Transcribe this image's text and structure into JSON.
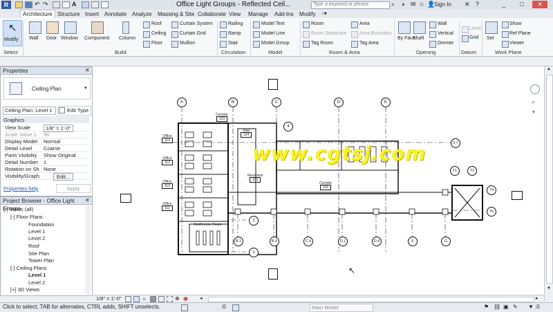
{
  "titlebar": {
    "title": "Office Light Groups - Reflected Ceil...",
    "search_placeholder": "Type a keyword or phrase",
    "signin": "Sign In",
    "min": "_",
    "max": "□",
    "close": "✕"
  },
  "tabs": [
    "Architecture",
    "Structure",
    "Insert",
    "Annotate",
    "Analyze",
    "Massing & Site",
    "Collaborate",
    "View",
    "Manage",
    "Add-Ins",
    "Modify"
  ],
  "ribbon": {
    "select": "Select",
    "build": {
      "title": "Build",
      "modify": "Modify",
      "wall": "Wall",
      "door": "Door",
      "window": "Window",
      "component": "Component",
      "column": "Column",
      "roof": "Roof",
      "ceiling": "Ceiling",
      "floor": "Floor",
      "curtain_system": "Curtain System",
      "curtain_grid": "Curtain Grid",
      "mullion": "Mullion"
    },
    "circulation": {
      "title": "Circulation",
      "railing": "Railing",
      "ramp": "Ramp",
      "stair": "Stair"
    },
    "model": {
      "title": "Model",
      "model_text": "Model Text",
      "model_line": "Model Line",
      "model_group": "Model Group"
    },
    "room_area": {
      "title": "Room & Area",
      "room": "Room",
      "room_separator": "Room Separator",
      "tag_room": "Tag Room",
      "area": "Area",
      "area_boundary": "Area Boundary",
      "tag_area": "Tag Area"
    },
    "opening": {
      "title": "Opening",
      "by_face": "By Face",
      "shaft": "Shaft",
      "wall": "Wall",
      "vertical": "Vertical",
      "dormer": "Dormer"
    },
    "datum": {
      "title": "Datum",
      "level": "Level",
      "grid": "Grid"
    },
    "work_plane": {
      "title": "Work Plane",
      "set": "Set",
      "show": "Show",
      "ref_plane": "Ref Plane",
      "viewer": "Viewer"
    }
  },
  "properties": {
    "header": "Properties",
    "type": "Ceiling Plan",
    "selector": "Ceiling Plan: Level 1",
    "edit_type": "Edit Type",
    "section": "Graphics",
    "rows": [
      {
        "k": "View Scale",
        "v": "1/8\" = 1'-0\""
      },
      {
        "k": "Scale Value   1:",
        "v": "96"
      },
      {
        "k": "Display Model",
        "v": "Normal"
      },
      {
        "k": "Detail Level",
        "v": "Coarse"
      },
      {
        "k": "Parts Visibility",
        "v": "Show Original"
      },
      {
        "k": "Detail Number",
        "v": "1"
      },
      {
        "k": "Rotation on Sh...",
        "v": "None"
      },
      {
        "k": "Visibility/Graph...",
        "v": "Edit..."
      }
    ],
    "help": "Properties help",
    "apply": "Apply"
  },
  "browser": {
    "header": "Project Browser - Office Light Groups",
    "nodes": [
      {
        "t": "[-] Views (all)",
        "d": 0
      },
      {
        "t": "[-] Floor Plans",
        "d": 1
      },
      {
        "t": "Foundation",
        "d": 2
      },
      {
        "t": "Level 1",
        "d": 2
      },
      {
        "t": "Level 2",
        "d": 2
      },
      {
        "t": "Roof",
        "d": 2
      },
      {
        "t": "Site Plan",
        "d": 2
      },
      {
        "t": "Tower Plan",
        "d": 2
      },
      {
        "t": "[-] Ceiling Plans",
        "d": 1
      },
      {
        "t": "Level 1",
        "d": 2,
        "bold": true
      },
      {
        "t": "Level 2",
        "d": 2
      },
      {
        "t": "[+] 3D Views",
        "d": 1
      }
    ]
  },
  "drawing": {
    "grids_top": [
      "A",
      "B",
      "C",
      "D",
      "E"
    ],
    "grids_bottom": [
      "B.1",
      "B.9",
      "C.5",
      "D.1",
      "D.8",
      "F",
      "G"
    ],
    "grids_right": [
      "3.7",
      "T1",
      "T2",
      "T4",
      "T6"
    ],
    "bubbles_left": [
      "2",
      "1"
    ],
    "bubble_upper": "4",
    "rooms": [
      {
        "label": "Corridor",
        "num": "123"
      },
      {
        "label": "Office",
        "num": "114"
      },
      {
        "label": "Office",
        "num": "113"
      },
      {
        "label": "Office",
        "num": "112"
      },
      {
        "label": "Office",
        "num": "111"
      },
      {
        "label": "Stair",
        "num": "124"
      },
      {
        "label": "Conference Room",
        "num": ""
      },
      {
        "label": "Reception",
        "num": "101"
      },
      {
        "label": "Corridor",
        "num": "102"
      }
    ]
  },
  "watermark": "www.cgtsj.com",
  "viewbar": {
    "scale": "1/8\" = 1'-0\""
  },
  "status": {
    "hint": "Click to select, TAB for alternates, CTRL adds, SHIFT unselects.",
    "zero": ":0",
    "model": "Main Model"
  }
}
